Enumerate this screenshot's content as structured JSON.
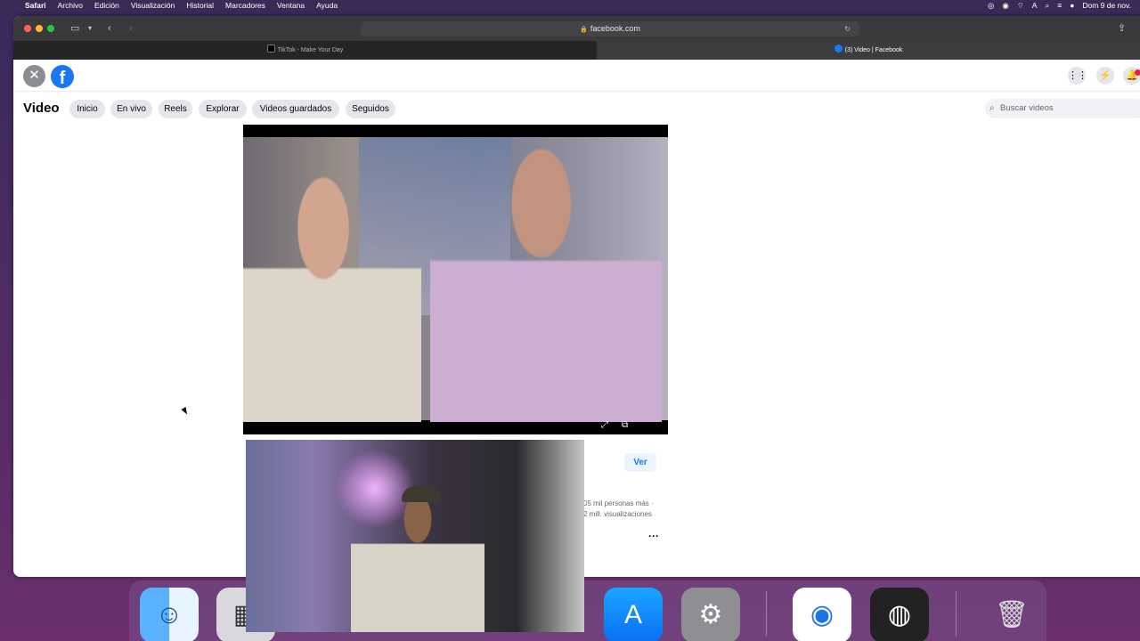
{
  "menubar": {
    "items": [
      "Safari",
      "Archivo",
      "Edición",
      "Visualización",
      "Historial",
      "Marcadores",
      "Ventana",
      "Ayuda"
    ],
    "datetime": "Dom 9 de nov."
  },
  "browser": {
    "url": "facebook.com",
    "tabs": [
      {
        "label": "TikTok - Make Your Day"
      },
      {
        "label": "(3) Video | Facebook"
      }
    ]
  },
  "facebook": {
    "logo_letter": "f",
    "section_title": "Video",
    "nav_pills": [
      {
        "label": "Inicio"
      },
      {
        "label": "En vivo"
      },
      {
        "label": "Reels"
      },
      {
        "label": "Explorar"
      },
      {
        "label": "Videos guardados"
      },
      {
        "label": "Seguidos"
      }
    ],
    "search_placeholder": "Buscar videos",
    "video_panel": {
      "ver_button": "Ver",
      "stats_line1": "05 mil personas más ·",
      "stats_line2": "2 mill. visualizaciones",
      "more_label": "···"
    }
  },
  "icons": {
    "close": "close-icon",
    "apps": "grid-icon",
    "messenger": "messenger-icon",
    "notifications": "bell-icon",
    "search": "search-icon"
  }
}
